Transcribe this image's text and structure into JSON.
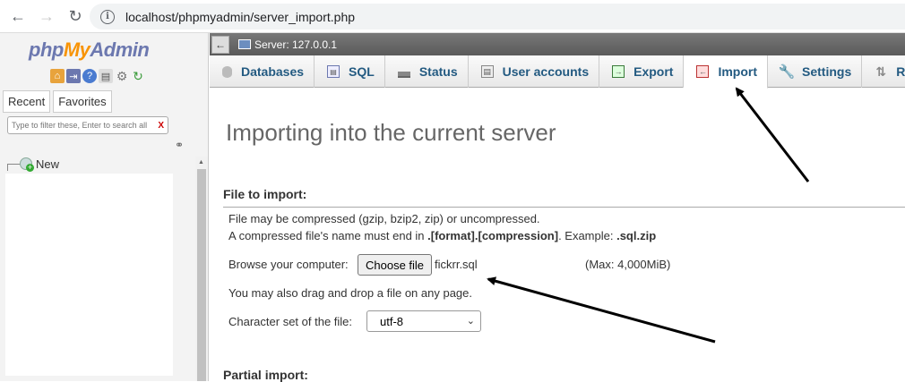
{
  "browser": {
    "url": "localhost/phpmyadmin/server_import.php",
    "back_icon": "arrow-left-icon",
    "forward_icon": "arrow-right-icon",
    "reload_icon": "reload-icon",
    "info_icon": "info-icon"
  },
  "sidebar": {
    "logo": {
      "php": "php",
      "my": "My",
      "admin": "Admin"
    },
    "tabs": [
      "Recent",
      "Favorites"
    ],
    "filter_placeholder": "Type to filter these, Enter to search all",
    "filter_clear": "X",
    "tree": {
      "new_label": "New"
    }
  },
  "server": {
    "label": "Server: 127.0.0.1",
    "collapse": "←"
  },
  "tabs": [
    {
      "label": "Databases",
      "icon": "database-icon"
    },
    {
      "label": "SQL",
      "icon": "sql-icon"
    },
    {
      "label": "Status",
      "icon": "status-icon"
    },
    {
      "label": "User accounts",
      "icon": "user-accounts-icon"
    },
    {
      "label": "Export",
      "icon": "export-icon"
    },
    {
      "label": "Import",
      "icon": "import-icon",
      "active": true
    },
    {
      "label": "Settings",
      "icon": "wrench-icon"
    },
    {
      "label": "Replica",
      "icon": "replication-icon"
    }
  ],
  "main": {
    "title": "Importing into the current server",
    "file_section": "File to import:",
    "compress_note": "File may be compressed (gzip, bzip2, zip) or uncompressed.",
    "compress_name_pre": "A compressed file's name must end in ",
    "compress_name_format": ".[format].[compression]",
    "compress_name_mid": ". Example: ",
    "compress_name_example": ".sql.zip",
    "browse_label": "Browse your computer:",
    "choose_file": "Choose file",
    "file_name": "fickrr.sql",
    "max_size": "(Max: 4,000MiB)",
    "drag_note": "You may also drag and drop a file on any page.",
    "charset_label": "Character set of the file:",
    "charset_value": "utf-8",
    "partial_section": "Partial import:"
  }
}
